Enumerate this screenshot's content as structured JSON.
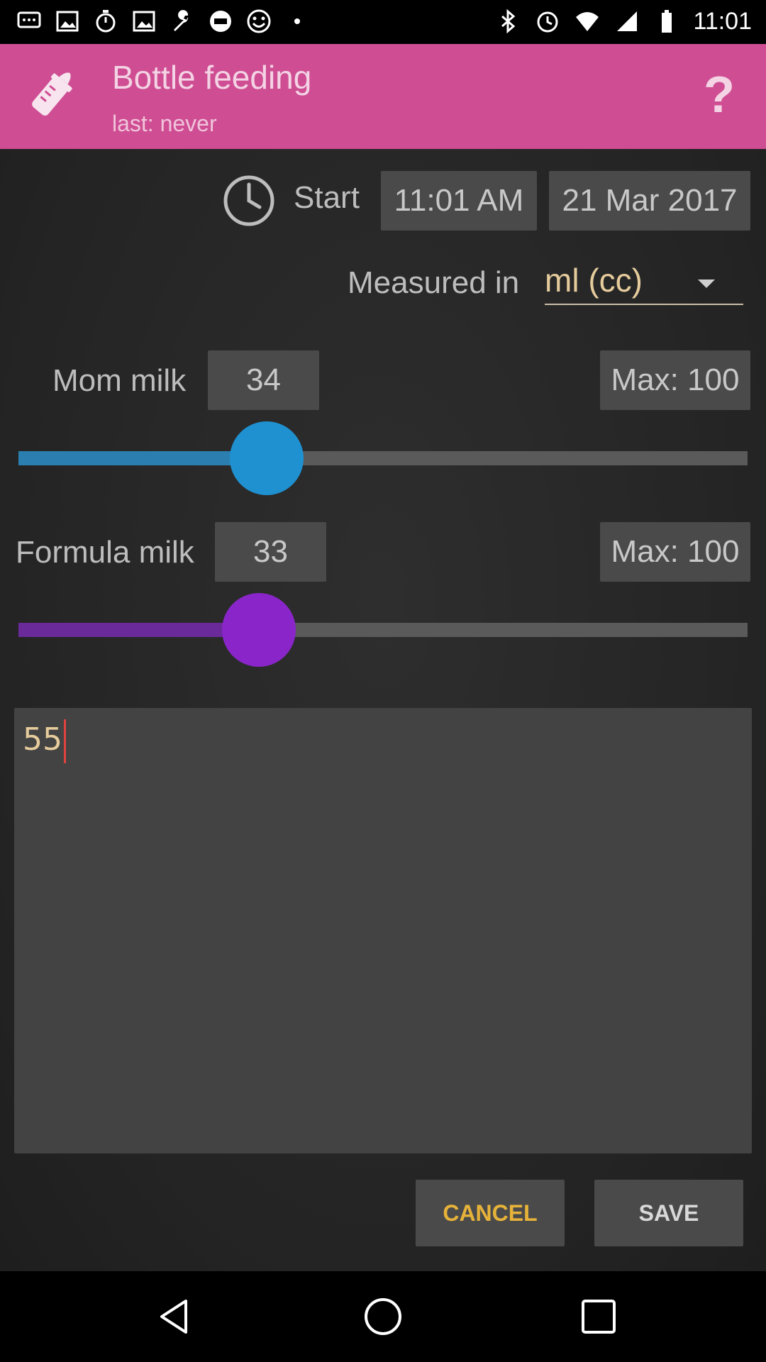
{
  "status_bar": {
    "time": "11:01",
    "left_icons": [
      "message-icon",
      "image-icon",
      "stopwatch-icon",
      "image-icon",
      "wrench-icon",
      "fox-sports-icon",
      "smiley-icon",
      "dots-icon"
    ],
    "right_icons": [
      "bluetooth-icon",
      "alarm-icon",
      "wifi-icon",
      "signal-icon",
      "battery-icon"
    ]
  },
  "header": {
    "title": "Bottle feeding",
    "subtitle": "last: never",
    "help_label": "?",
    "color": "#cf4d93"
  },
  "start": {
    "label": "Start",
    "time": "11:01 AM",
    "date": "21 Mar 2017"
  },
  "measure": {
    "label": "Measured in",
    "selected_unit": "ml (cc)"
  },
  "mom_milk": {
    "label": "Mom milk",
    "value": "34",
    "max_label": "Max: 100",
    "fraction": 0.34,
    "color": "#1f91d1"
  },
  "formula_milk": {
    "label": "Formula milk",
    "value": "33",
    "max_label": "Max: 100",
    "fraction": 0.33,
    "color": "#8a26c9"
  },
  "notes": {
    "value": "55"
  },
  "actions": {
    "cancel_label": "CANCEL",
    "save_label": "SAVE"
  },
  "nav": {
    "icons": [
      "back-icon",
      "home-icon",
      "recent-apps-icon"
    ]
  }
}
